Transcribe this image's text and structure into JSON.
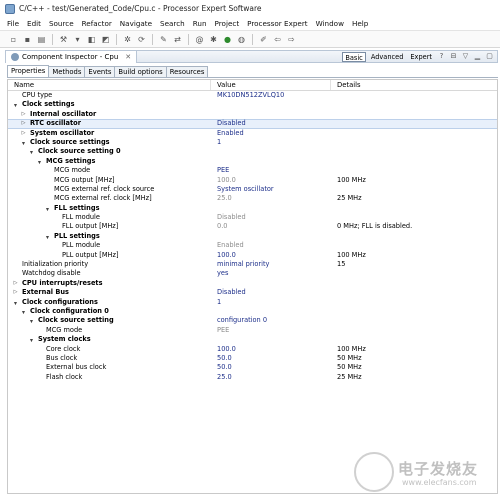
{
  "window": {
    "title": "C/C++ - test/Generated_Code/Cpu.c - Processor Expert Software"
  },
  "menu": [
    "File",
    "Edit",
    "Source",
    "Refactor",
    "Navigate",
    "Search",
    "Run",
    "Project",
    "Processor Expert",
    "Window",
    "Help"
  ],
  "view": {
    "tab_label": "Component Inspector - Cpu",
    "modes": [
      "Basic",
      "Advanced",
      "Expert"
    ],
    "active_mode": "Basic"
  },
  "subtabs": [
    "Properties",
    "Methods",
    "Events",
    "Build options",
    "Resources"
  ],
  "table": {
    "headers": [
      "Name",
      "Value",
      "Details"
    ],
    "rows": [
      {
        "indent": 1,
        "toggle": "",
        "name": "CPU type",
        "bold": false,
        "value": "MK10DN512ZVLQ10",
        "vstyle": "v",
        "details": ""
      },
      {
        "indent": 1,
        "toggle": "▲",
        "name": "Clock settings",
        "bold": true,
        "value": "",
        "vstyle": "v",
        "details": ""
      },
      {
        "indent": 2,
        "toggle": "▷",
        "name": "Internal oscillator",
        "bold": true,
        "value": "",
        "vstyle": "v",
        "details": ""
      },
      {
        "indent": 2,
        "toggle": "▷",
        "name": "RTC oscillator",
        "bold": true,
        "value": "Disabled",
        "vstyle": "v",
        "details": "",
        "hl": true
      },
      {
        "indent": 2,
        "toggle": "▷",
        "name": "System oscillator",
        "bold": true,
        "value": "Enabled",
        "vstyle": "v",
        "details": ""
      },
      {
        "indent": 2,
        "toggle": "▲",
        "name": "Clock source settings",
        "bold": true,
        "value": "1",
        "vstyle": "v",
        "details": ""
      },
      {
        "indent": 3,
        "toggle": "▲",
        "name": "Clock source setting 0",
        "bold": true,
        "value": "",
        "vstyle": "v",
        "details": ""
      },
      {
        "indent": 4,
        "toggle": "▲",
        "name": "MCG settings",
        "bold": true,
        "value": "",
        "vstyle": "v",
        "details": ""
      },
      {
        "indent": 5,
        "toggle": "",
        "name": "MCG mode",
        "bold": false,
        "value": "PEE",
        "vstyle": "v",
        "details": ""
      },
      {
        "indent": 5,
        "toggle": "",
        "name": "MCG output [MHz]",
        "bold": false,
        "value": "100.0",
        "vstyle": "g",
        "details": "100 MHz"
      },
      {
        "indent": 5,
        "toggle": "",
        "name": "MCG external ref. clock source",
        "bold": false,
        "value": "System oscillator",
        "vstyle": "v",
        "details": ""
      },
      {
        "indent": 5,
        "toggle": "",
        "name": "MCG external ref. clock [MHz]",
        "bold": false,
        "value": "25.0",
        "vstyle": "g",
        "details": "25 MHz"
      },
      {
        "indent": 5,
        "toggle": "▲",
        "name": "FLL settings",
        "bold": true,
        "value": "",
        "vstyle": "v",
        "details": ""
      },
      {
        "indent": 6,
        "toggle": "",
        "name": "FLL module",
        "bold": false,
        "value": "Disabled",
        "vstyle": "g",
        "details": ""
      },
      {
        "indent": 6,
        "toggle": "",
        "name": "FLL output [MHz]",
        "bold": false,
        "value": "0.0",
        "vstyle": "g",
        "details": "0 MHz; FLL is disabled."
      },
      {
        "indent": 5,
        "toggle": "▲",
        "name": "PLL settings",
        "bold": true,
        "value": "",
        "vstyle": "v",
        "details": ""
      },
      {
        "indent": 6,
        "toggle": "",
        "name": "PLL module",
        "bold": false,
        "value": "Enabled",
        "vstyle": "g",
        "details": ""
      },
      {
        "indent": 6,
        "toggle": "",
        "name": "PLL output [MHz]",
        "bold": false,
        "value": "100.0",
        "vstyle": "v",
        "details": "100 MHz"
      },
      {
        "indent": 1,
        "toggle": "",
        "name": "Initialization priority",
        "bold": false,
        "value": "minimal priority",
        "vstyle": "v",
        "details": "15"
      },
      {
        "indent": 1,
        "toggle": "",
        "name": "Watchdog disable",
        "bold": false,
        "value": "yes",
        "vstyle": "v",
        "details": ""
      },
      {
        "indent": 1,
        "toggle": "▷",
        "name": "CPU interrupts/resets",
        "bold": true,
        "value": "",
        "vstyle": "v",
        "details": ""
      },
      {
        "indent": 1,
        "toggle": "▷",
        "name": "External Bus",
        "bold": true,
        "value": "Disabled",
        "vstyle": "v",
        "details": ""
      },
      {
        "indent": 1,
        "toggle": "▲",
        "name": "Clock configurations",
        "bold": true,
        "value": "1",
        "vstyle": "v",
        "details": ""
      },
      {
        "indent": 2,
        "toggle": "▲",
        "name": "Clock configuration 0",
        "bold": true,
        "value": "",
        "vstyle": "v",
        "details": ""
      },
      {
        "indent": 3,
        "toggle": "▲",
        "name": "Clock source setting",
        "bold": true,
        "value": "configuration 0",
        "vstyle": "v",
        "details": ""
      },
      {
        "indent": 4,
        "toggle": "",
        "name": "MCG mode",
        "bold": false,
        "value": "PEE",
        "vstyle": "g",
        "details": ""
      },
      {
        "indent": 3,
        "toggle": "▲",
        "name": "System clocks",
        "bold": true,
        "value": "",
        "vstyle": "v",
        "details": ""
      },
      {
        "indent": 4,
        "toggle": "",
        "name": "Core clock",
        "bold": false,
        "value": "100.0",
        "vstyle": "v",
        "details": "100 MHz"
      },
      {
        "indent": 4,
        "toggle": "",
        "name": "Bus clock",
        "bold": false,
        "value": "50.0",
        "vstyle": "v",
        "details": "50 MHz"
      },
      {
        "indent": 4,
        "toggle": "",
        "name": "External bus clock",
        "bold": false,
        "value": "50.0",
        "vstyle": "v",
        "details": "50 MHz"
      },
      {
        "indent": 4,
        "toggle": "",
        "name": "Flash clock",
        "bold": false,
        "value": "25.0",
        "vstyle": "v",
        "details": "25 MHz"
      }
    ]
  },
  "watermark": {
    "line1": "电子发烧友",
    "line2": "www.elecfans.com"
  }
}
